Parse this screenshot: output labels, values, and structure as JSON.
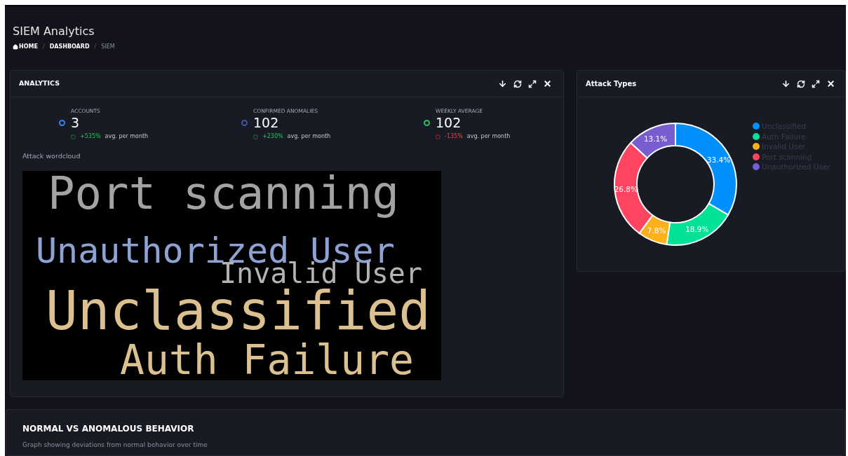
{
  "page": {
    "title": "SIEM Analytics",
    "separator": "/",
    "breadcrumb": [
      {
        "label": "HOME",
        "kind": "home",
        "current": false
      },
      {
        "label": "DASHBOARD",
        "kind": "link",
        "current": false
      },
      {
        "label": "SIEM",
        "kind": "link",
        "current": true
      }
    ]
  },
  "analytics": {
    "title": "ANALYTICS",
    "stats": [
      {
        "label": "ACCOUNTS",
        "value": "3",
        "color": "#3b82f6",
        "negative": false,
        "change": "+535%",
        "note": "avg. per month"
      },
      {
        "label": "CONFIRMED ANOMALIES",
        "value": "102",
        "color": "#3b5ba9",
        "negative": false,
        "change": "+230%",
        "note": "avg. per month"
      },
      {
        "label": "WEEKLY AVERAGE",
        "value": "102",
        "color": "#22c55e",
        "negative": true,
        "change": "-135%",
        "note": "avg. per month"
      }
    ],
    "wordcloud_label": "Attack wordcloud",
    "words": [
      {
        "text": "Port scanning",
        "color": "#a3a3a3"
      },
      {
        "text": "Unauthorized User",
        "color": "#8ea2d4"
      },
      {
        "text": "Invalid User",
        "color": "#b3b3b3"
      },
      {
        "text": "Unclassified",
        "color": "#dcc08f"
      },
      {
        "text": "Auth Failure",
        "color": "#dcc08f"
      }
    ]
  },
  "attack_types": {
    "title": "Attack Types",
    "chart_data": {
      "type": "donut",
      "categories": [
        "Unclassified",
        "Auth Failure",
        "Invalid User",
        "Port scanning",
        "Unauthorized User"
      ],
      "legend": true,
      "series": [
        {
          "colors": [
            "#008ffb",
            "#00e396",
            "#feb019",
            "#ff4560",
            "#775dd0"
          ],
          "values": [
            33.4,
            18.9,
            7.8,
            26.8,
            13.1
          ],
          "value_labels": [
            "33.4%",
            "18.9%",
            "7.8%",
            "26.8%",
            "13.1%"
          ]
        }
      ],
      "data_labels": true
    }
  },
  "behavior": {
    "title": "NORMAL VS ANOMALOUS BEHAVIOR",
    "subtitle": "Graph showing deviations from normal behavior over time"
  }
}
